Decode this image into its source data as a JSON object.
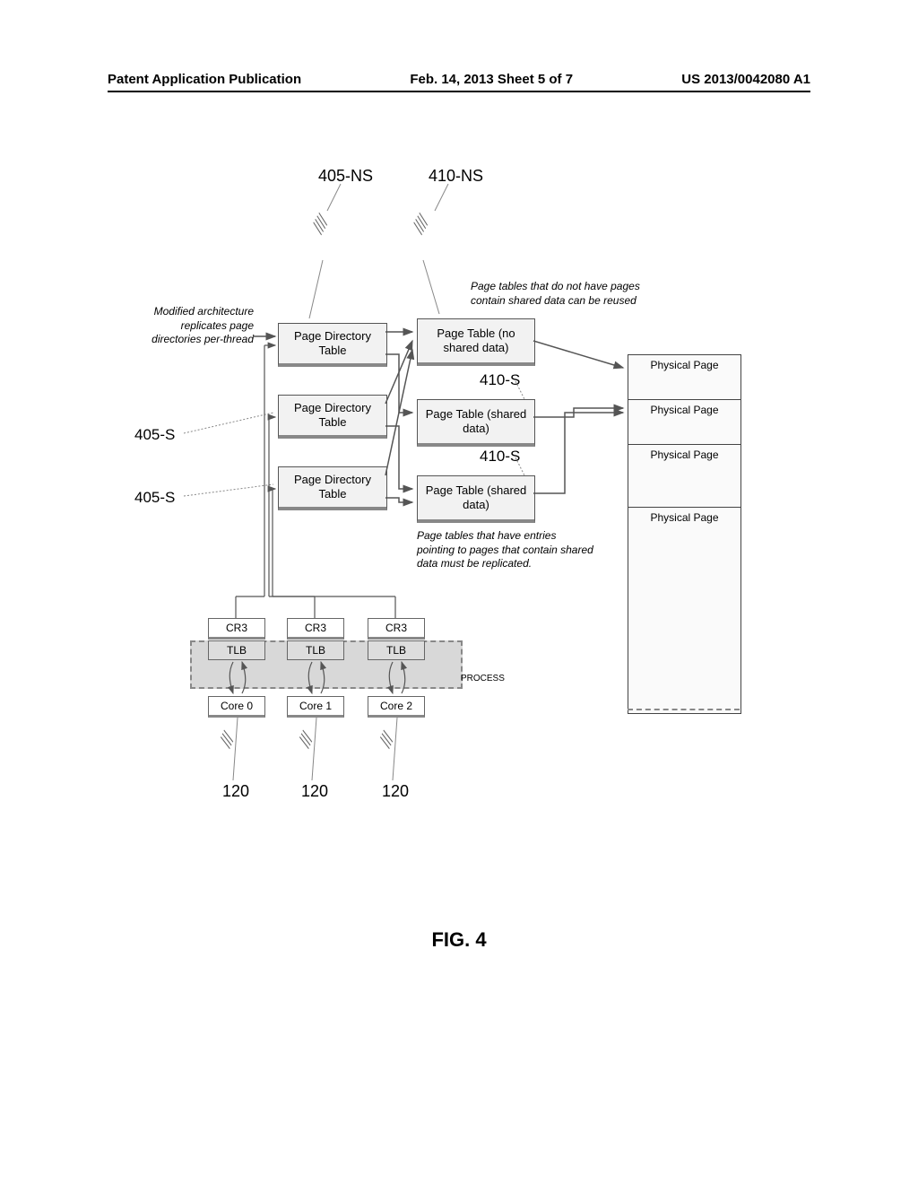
{
  "header": {
    "left": "Patent Application Publication",
    "center": "Feb. 14, 2013  Sheet 5 of 7",
    "right": "US 2013/0042080 A1"
  },
  "refs": {
    "r405ns": "405-NS",
    "r410ns": "410-NS",
    "r405s_top": "405-S",
    "r405s_bot": "405-S",
    "r410s_top": "410-S",
    "r410s_bot": "410-S",
    "r120_a": "120",
    "r120_b": "120",
    "r120_c": "120"
  },
  "annotations": {
    "modified": "Modified architecture replicates page directories per-thread",
    "reused": "Page tables that do not have pages contain shared data can be reused",
    "replicated": "Page tables that have entries pointing to pages that contain shared data must be replicated."
  },
  "boxes": {
    "pdt1": "Page Directory Table",
    "pdt2": "Page Directory Table",
    "pdt3": "Page Directory Table",
    "pt_noshared": "Page Table (no shared data)",
    "pt_shared1": "Page Table (shared data)",
    "pt_shared2": "Page Table (shared data)",
    "phys1": "Physical Page",
    "phys2": "Physical Page",
    "phys3": "Physical Page",
    "phys4": "Physical Page"
  },
  "cores": {
    "cr3": "CR3",
    "tlb": "TLB",
    "core0": "Core 0",
    "core1": "Core 1",
    "core2": "Core 2",
    "process": "PROCESS"
  },
  "caption": "FIG. 4"
}
